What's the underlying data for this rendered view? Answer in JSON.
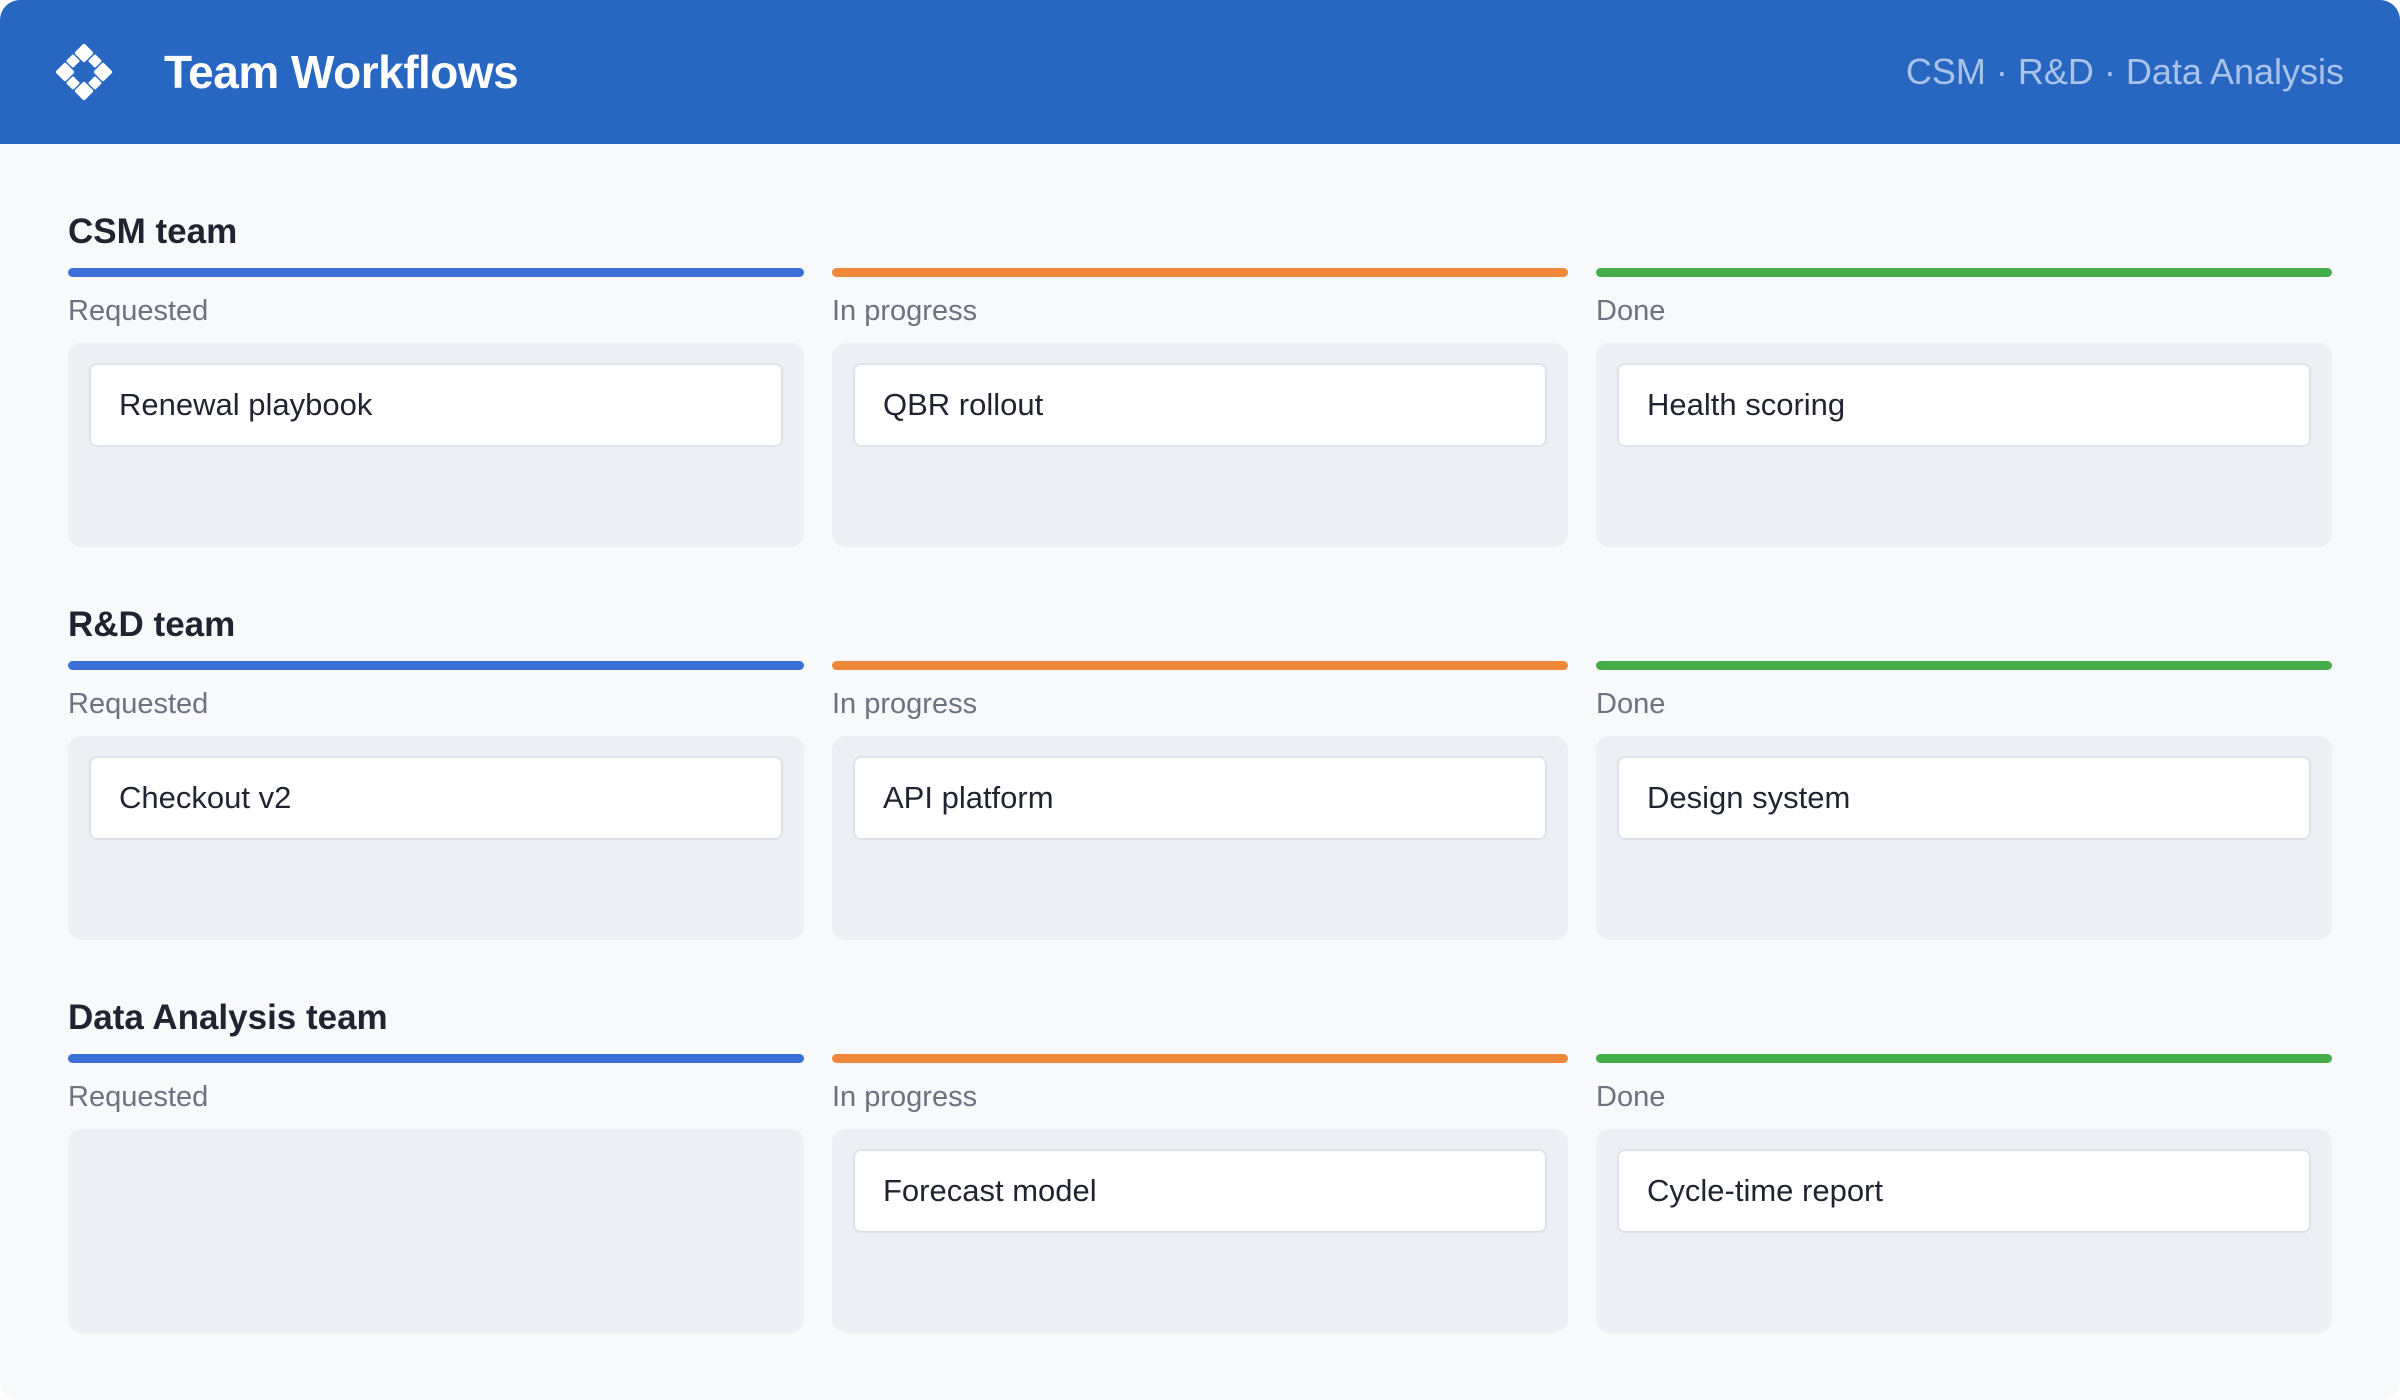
{
  "header": {
    "title": "Team Workflows",
    "subtitle": "CSM · R&D · Data Analysis",
    "background": "#2767c2",
    "logo_icon": "diamond-grid-icon"
  },
  "status_colors": {
    "requested": "#3b70d8",
    "in_progress": "#f0883a",
    "done": "#44ae4a"
  },
  "teams": [
    {
      "title": "CSM team",
      "columns": [
        {
          "label": "Requested",
          "status": "requested",
          "cards": [
            "Renewal playbook"
          ]
        },
        {
          "label": "In progress",
          "status": "in_progress",
          "cards": [
            "QBR rollout"
          ]
        },
        {
          "label": "Done",
          "status": "done",
          "cards": [
            "Health scoring"
          ]
        }
      ]
    },
    {
      "title": "R&D team",
      "columns": [
        {
          "label": "Requested",
          "status": "requested",
          "cards": [
            "Checkout v2"
          ]
        },
        {
          "label": "In progress",
          "status": "in_progress",
          "cards": [
            "API platform"
          ]
        },
        {
          "label": "Done",
          "status": "done",
          "cards": [
            "Design system"
          ]
        }
      ]
    },
    {
      "title": "Data Analysis team",
      "columns": [
        {
          "label": "Requested",
          "status": "requested",
          "cards": []
        },
        {
          "label": "In progress",
          "status": "in_progress",
          "cards": [
            "Forecast model"
          ]
        },
        {
          "label": "Done",
          "status": "done",
          "cards": [
            "Cycle-time report"
          ]
        }
      ]
    }
  ]
}
